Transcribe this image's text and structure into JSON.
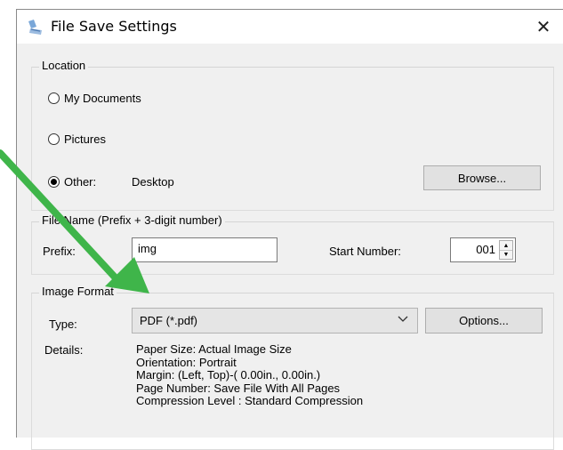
{
  "window": {
    "title": "File Save Settings",
    "close_label": "✕"
  },
  "location": {
    "legend": "Location",
    "options": [
      {
        "label": "My Documents",
        "checked": false
      },
      {
        "label": "Pictures",
        "checked": false
      },
      {
        "label": "Other:",
        "checked": true
      }
    ],
    "other_path": "Desktop",
    "browse_label": "Browse..."
  },
  "file_name": {
    "legend": "File Name (Prefix + 3-digit number)",
    "prefix_label": "Prefix:",
    "prefix_value": "img",
    "start_label": "Start Number:",
    "start_value": "001"
  },
  "image_format": {
    "legend": "Image Format",
    "type_label": "Type:",
    "type_value": "PDF (*.pdf)",
    "options_label": "Options...",
    "details_label": "Details:",
    "details": [
      "Paper Size: Actual Image Size",
      "Orientation: Portrait",
      "Margin: (Left, Top)-( 0.00in., 0.00in.)",
      "Page Number: Save File With All Pages",
      "Compression Level : Standard Compression"
    ]
  },
  "colors": {
    "annotation_arrow": "#3fb54a"
  }
}
